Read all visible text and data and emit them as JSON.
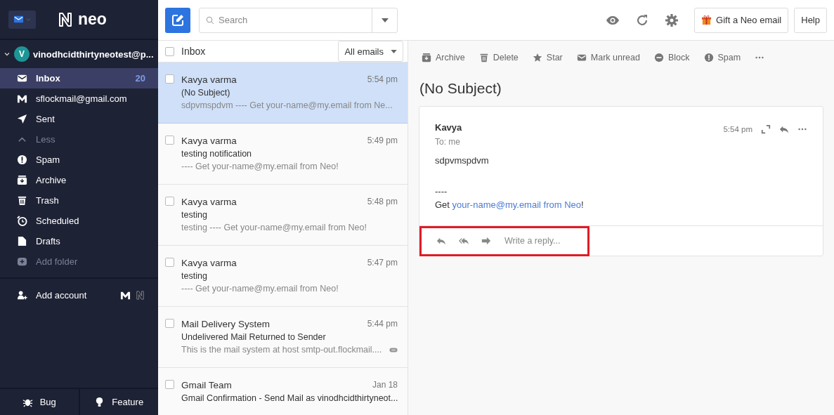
{
  "sidebar": {
    "logo": "neo",
    "account": {
      "initial": "V",
      "email": "vinodhcidthirtyneotest@p...",
      "expanded": true
    },
    "folders": [
      {
        "kind": "folder",
        "label": "Inbox",
        "count": "20",
        "selected": true
      },
      {
        "kind": "folder",
        "label": "sflockmail@gmail.com",
        "selected": false
      },
      {
        "kind": "folder",
        "label": "Sent",
        "selected": false
      },
      {
        "kind": "toggle",
        "label": "Less",
        "selected": false
      },
      {
        "kind": "folder",
        "label": "Spam",
        "selected": false
      },
      {
        "kind": "folder",
        "label": "Archive",
        "selected": false
      },
      {
        "kind": "folder",
        "label": "Trash",
        "selected": false
      },
      {
        "kind": "folder",
        "label": "Scheduled",
        "selected": false
      },
      {
        "kind": "folder",
        "label": "Drafts",
        "selected": false
      },
      {
        "kind": "action",
        "label": "Add folder",
        "selected": false
      }
    ],
    "add_account": "Add account",
    "footer": [
      "Bug",
      "Feature"
    ]
  },
  "topbar": {
    "search": {
      "placeholder": "Search"
    },
    "gift_button": "Gift a Neo email",
    "help_button": "Help"
  },
  "mail_list": {
    "title": "Inbox",
    "all_checked": false,
    "filter": "All emails",
    "rows": [
      {
        "sender": "Kavya varma",
        "time": "5:54 pm",
        "subject": "(No Subject)",
        "preview": "sdpvmspdvm ---- Get your-name@my.email from Ne...",
        "selected": true,
        "checked": false,
        "attachment": false
      },
      {
        "sender": "Kavya varma",
        "time": "5:49 pm",
        "subject": "testing notification",
        "preview": "---- Get your-name@my.email from Neo!",
        "selected": false,
        "checked": false,
        "attachment": false
      },
      {
        "sender": "Kavya varma",
        "time": "5:48 pm",
        "subject": "testing",
        "preview": "testing ---- Get your-name@my.email from Neo!",
        "selected": false,
        "checked": false,
        "attachment": false
      },
      {
        "sender": "Kavya varma",
        "time": "5:47 pm",
        "subject": "testing",
        "preview": "---- Get your-name@my.email from Neo!",
        "selected": false,
        "checked": false,
        "attachment": false
      },
      {
        "sender": "Mail Delivery System",
        "time": "5:44 pm",
        "subject": "Undelivered Mail Returned to Sender",
        "preview": "This is the mail system at host smtp-out.flockmail....",
        "selected": false,
        "checked": false,
        "attachment": true
      },
      {
        "sender": "Gmail Team",
        "time": "Jan 18",
        "subject": "Gmail Confirmation - Send Mail as vinodhcidthirtyneot...",
        "selected": false,
        "checked": false,
        "attachment": false
      }
    ]
  },
  "reader": {
    "actions": [
      "Archive",
      "Delete",
      "Star",
      "Mark unread",
      "Block",
      "Spam"
    ],
    "subject": "(No Subject)",
    "message": {
      "sender": "Kavya",
      "to": "To: me",
      "time": "5:54 pm",
      "body": "sdpvmspdvm",
      "signature": {
        "dashes": "----",
        "prefix": "Get",
        "link": "your-name@my.email from Neo",
        "suffix": "!"
      }
    },
    "reply_bar": {
      "placeholder": "Write a reply...",
      "highlighted": true
    }
  }
}
